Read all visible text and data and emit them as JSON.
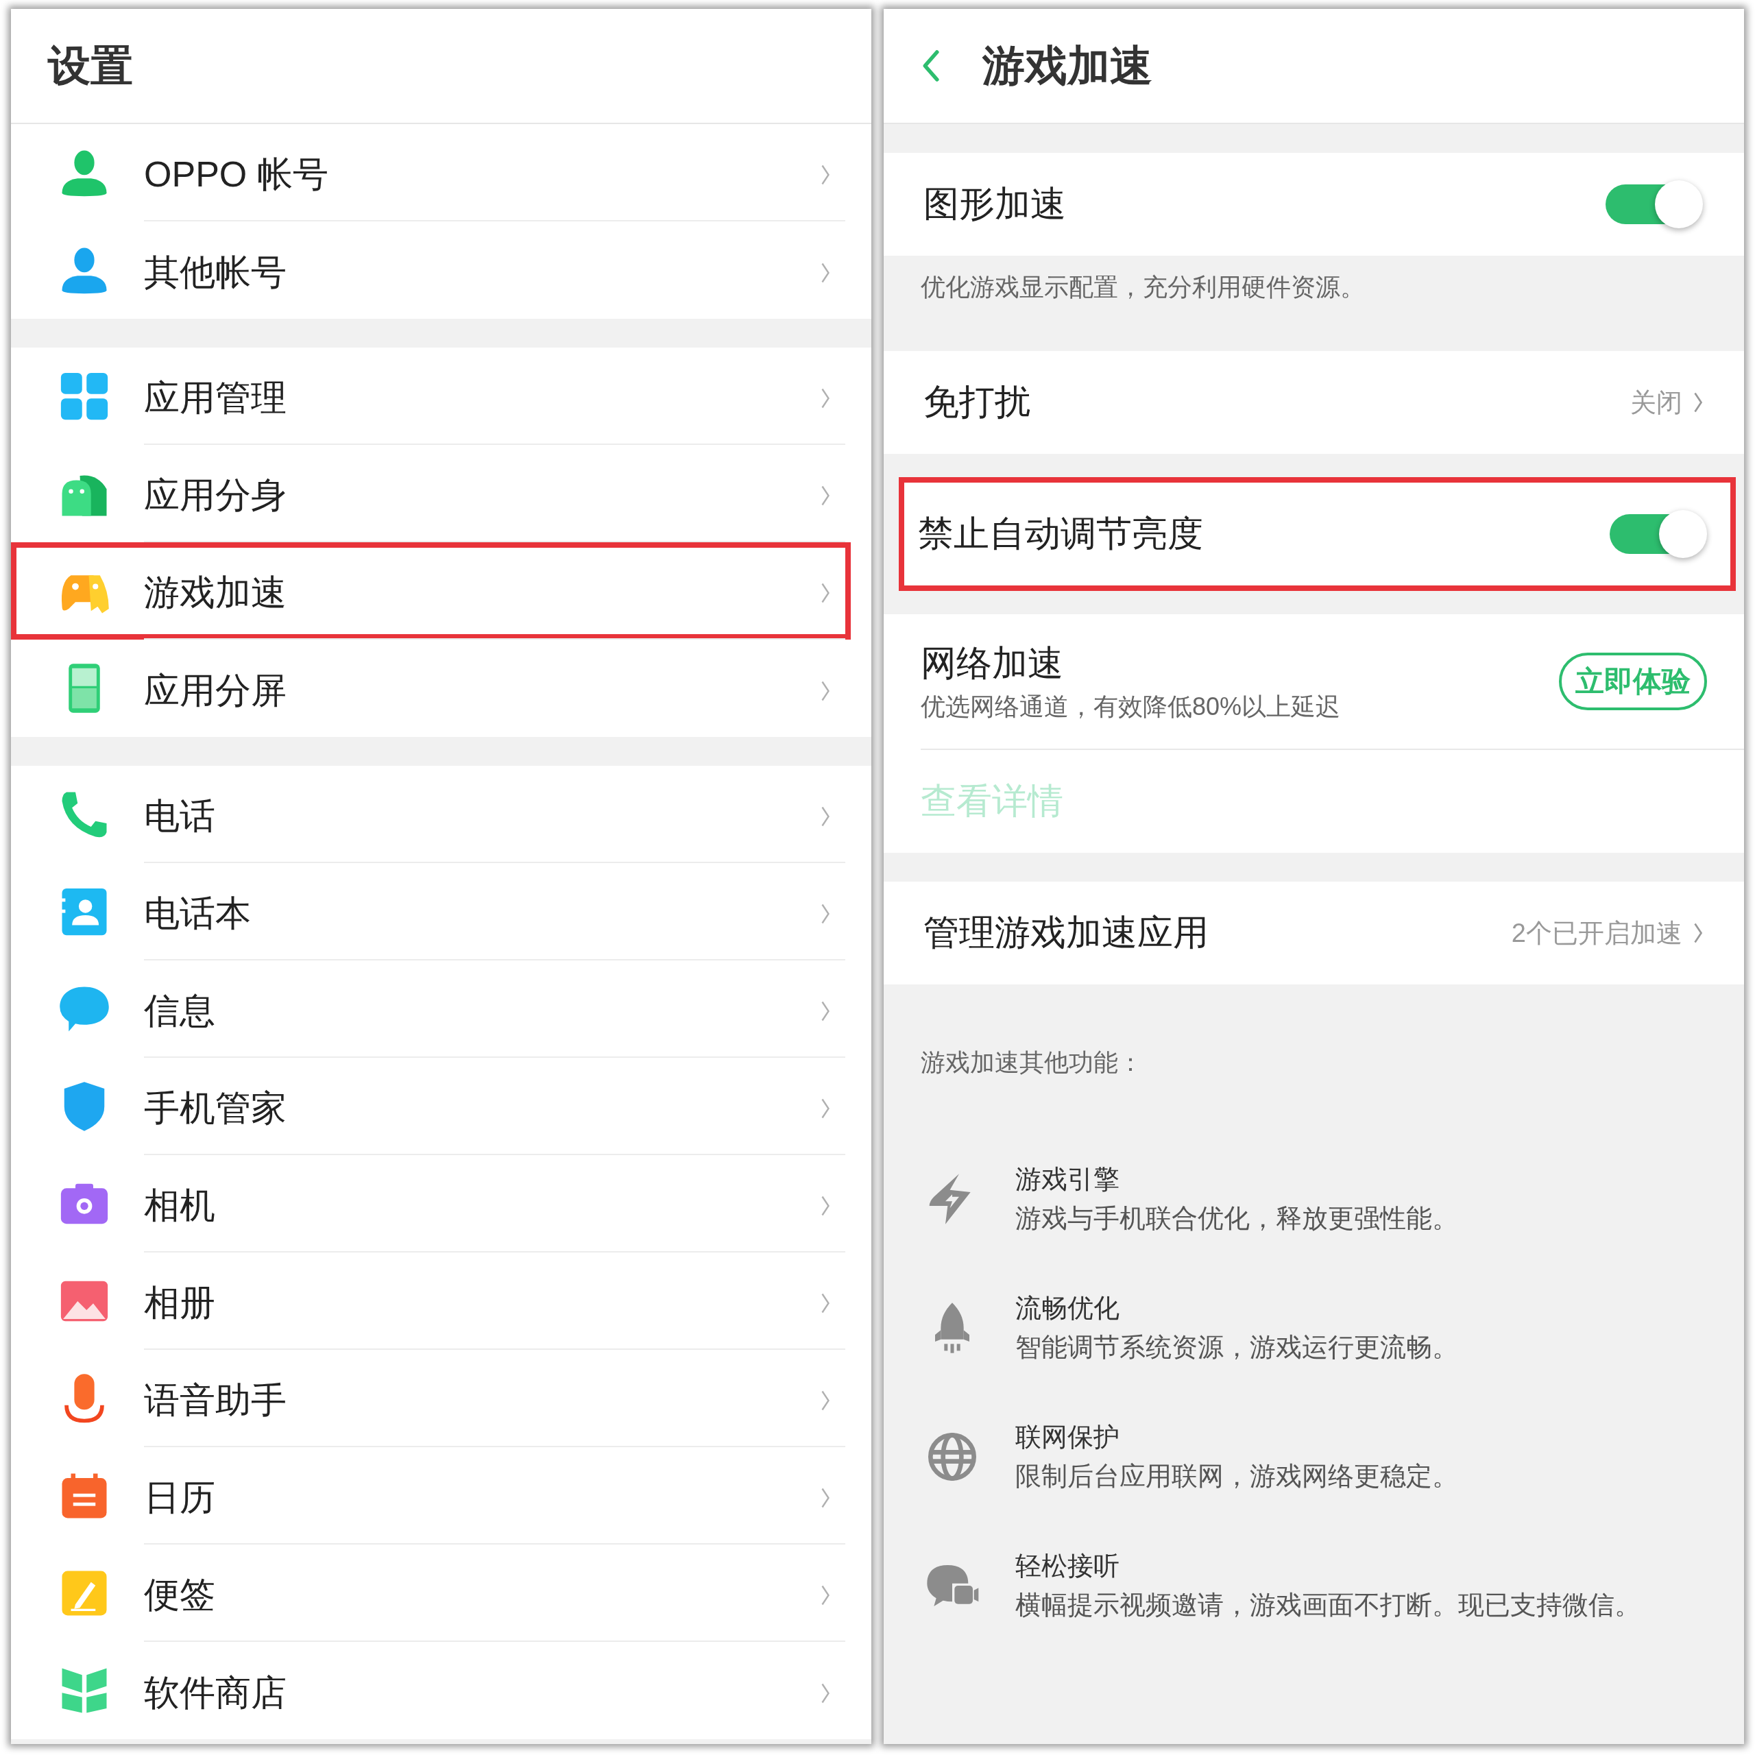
{
  "settings": {
    "title": "设置",
    "groups": [
      [
        {
          "kind": "person-green",
          "label": "OPPO 帐号",
          "highlighted": false
        },
        {
          "kind": "person-blue",
          "label": "其他帐号",
          "highlighted": false
        }
      ],
      [
        {
          "kind": "grid",
          "label": "应用管理",
          "highlighted": false
        },
        {
          "kind": "robot",
          "label": "应用分身",
          "highlighted": false
        },
        {
          "kind": "gamepad",
          "label": "游戏加速",
          "highlighted": true
        },
        {
          "kind": "tablet",
          "label": "应用分屏",
          "highlighted": false
        }
      ],
      [
        {
          "kind": "phone",
          "label": "电话",
          "highlighted": false
        },
        {
          "kind": "contact",
          "label": "电话本",
          "highlighted": false
        },
        {
          "kind": "chat",
          "label": "信息",
          "highlighted": false
        },
        {
          "kind": "shield",
          "label": "手机管家",
          "highlighted": false
        },
        {
          "kind": "camera",
          "label": "相机",
          "highlighted": false
        },
        {
          "kind": "image",
          "label": "相册",
          "highlighted": false
        },
        {
          "kind": "mic",
          "label": "语音助手",
          "highlighted": false
        },
        {
          "kind": "calendar",
          "label": "日历",
          "highlighted": false
        },
        {
          "kind": "note",
          "label": "便签",
          "highlighted": false
        },
        {
          "kind": "store",
          "label": "软件商店",
          "highlighted": false
        }
      ]
    ]
  },
  "game": {
    "title": "游戏加速",
    "graphics": {
      "label": "图形加速",
      "on": true,
      "highlighted": false
    },
    "graphics_note": "优化游戏显示配置，充分利用硬件资源。",
    "dnd": {
      "label": "免打扰",
      "value": "关闭",
      "highlighted": false
    },
    "brightness": {
      "label": "禁止自动调节亮度",
      "on": true,
      "highlighted": true
    },
    "network": {
      "label": "网络加速",
      "description": "优选网络通道，有效降低80%以上延迟",
      "button": "立即体验"
    },
    "details": {
      "label": "查看详情",
      "disabled": true
    },
    "manage": {
      "label": "管理游戏加速应用",
      "value": "2个已开启加速"
    },
    "features_heading": "游戏加速其他功能：",
    "features": [
      {
        "kind": "bolt",
        "title": "游戏引擎",
        "description": "游戏与手机联合优化，释放更强性能。"
      },
      {
        "kind": "rocket",
        "title": "流畅优化",
        "description": "智能调节系统资源，游戏运行更流畅。"
      },
      {
        "kind": "globe",
        "title": "联网保护",
        "description": "限制后台应用联网，游戏网络更稳定。"
      },
      {
        "kind": "chat-video",
        "title": "轻松接听",
        "description": "横幅提示视频邀请，游戏画面不打断。现已支持微信。"
      }
    ]
  }
}
